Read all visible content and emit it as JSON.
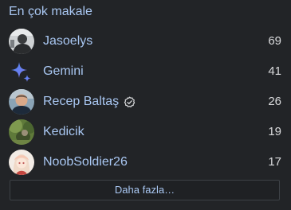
{
  "widget": {
    "title": "En çok makale",
    "more_label": "Daha fazla…"
  },
  "users": [
    {
      "name": "Jasoelys",
      "count": "69",
      "avatar": "grey-photo-avatar",
      "verified": false
    },
    {
      "name": "Gemini",
      "count": "41",
      "avatar": "gemini-sparkle-icon",
      "verified": false
    },
    {
      "name": "Recep Baltaş",
      "count": "26",
      "avatar": "person-photo-avatar",
      "verified": true
    },
    {
      "name": "Kedicik",
      "count": "19",
      "avatar": "green-photo-avatar",
      "verified": false
    },
    {
      "name": "NoobSoldier26",
      "count": "17",
      "avatar": "anime-avatar",
      "verified": false
    }
  ],
  "colors": {
    "background": "#222427",
    "link": "#a9c7f2",
    "text": "#d9dadc",
    "border": "#3d4146"
  }
}
